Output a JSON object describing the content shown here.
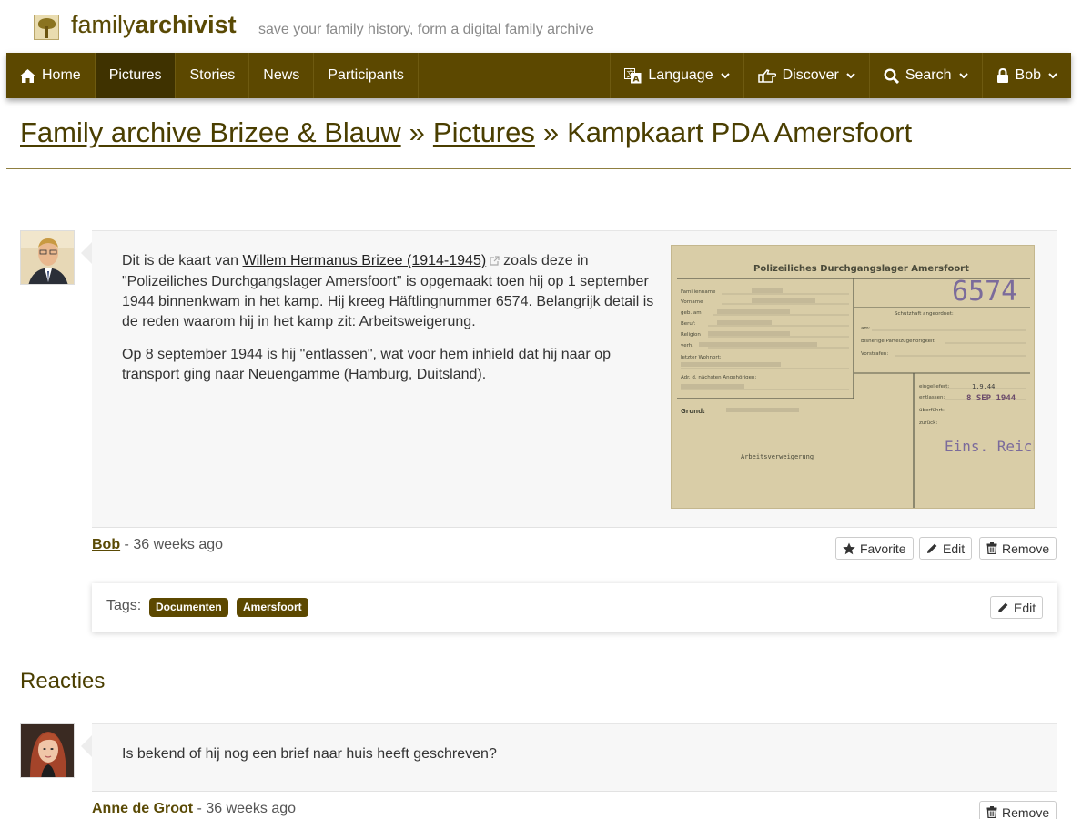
{
  "header": {
    "brand_light": "family",
    "brand_bold": "archivist",
    "tagline": "save your family history, form a digital family archive"
  },
  "nav": {
    "left": [
      {
        "label": "Home",
        "icon": "home-icon"
      },
      {
        "label": "Pictures",
        "active": true
      },
      {
        "label": "Stories"
      },
      {
        "label": "News"
      },
      {
        "label": "Participants"
      }
    ],
    "right": [
      {
        "label": "Language",
        "icon": "language-icon"
      },
      {
        "label": "Discover",
        "icon": "pointing-hand-icon"
      },
      {
        "label": "Search",
        "icon": "search-icon"
      },
      {
        "label": "Bob",
        "icon": "lock-icon"
      }
    ]
  },
  "breadcrumb": {
    "archive": "Family archive Brizee & Blauw",
    "section": "Pictures",
    "current": "Kampkaart PDA Amersfoort",
    "separator": "»"
  },
  "post": {
    "p1_before": "Dit is de kaart van",
    "p1_link": "Willem Hermanus Brizee (1914-1945)",
    "p1_after": "zoals deze in \"Polizeiliches Durchgangslager Amersfoort\" is opgemaakt toen hij op 1 september 1944 binnenkwam in het kamp. Hij kreeg Häftlingnummer 6574. Belangrijk detail is de reden waarom hij in het kamp zit: Arbeitsweigerung.",
    "p2": "Op 8 september 1944 is hij \"entlassen\", wat voor hem inhield dat hij naar op transport ging naar Neuengamme (Hamburg, Duitsland).",
    "author": "Bob",
    "time": " - 36 weeks ago",
    "buttons": {
      "favorite": "Favorite",
      "edit": "Edit",
      "remove": "Remove"
    }
  },
  "card": {
    "title": "Polizeiliches Durchgangslager Amersfoort",
    "number": "6574",
    "fields_left": [
      "Familienname",
      "Vorname",
      "geb. am",
      "Beruf:",
      "Religion",
      "verh.",
      "letzter Wohnort:",
      "Adr. d. nächsten Angehörigen:"
    ],
    "fields_right": [
      "Schutzhaft angeordnet:",
      "am:",
      "Bisherige Parteizugehörigkeit:",
      "Vorstrafen:"
    ],
    "release_fields": [
      "eingeliefert:",
      "entlassen:",
      "überführt:",
      "zurück:"
    ],
    "entered_date": "1.9.44",
    "released_date": "8 SEP 1944",
    "ground_label": "Grund:",
    "reason": "Arbeitsverweigerung",
    "stamp": "Eins. Reich"
  },
  "tags": {
    "label": "Tags:",
    "items": [
      "Documenten",
      "Amersfoort"
    ],
    "edit": "Edit"
  },
  "reactions": {
    "title": "Reacties",
    "comment": "Is bekend of hij nog een brief naar huis heeft geschreven?",
    "author": "Anne de Groot",
    "time": " - 36 weeks ago",
    "remove": "Remove"
  },
  "colors": {
    "brand": "#5c4800",
    "nav_active": "#3f3200",
    "link": "#4a3e00",
    "panel": "#f7f7f7"
  }
}
